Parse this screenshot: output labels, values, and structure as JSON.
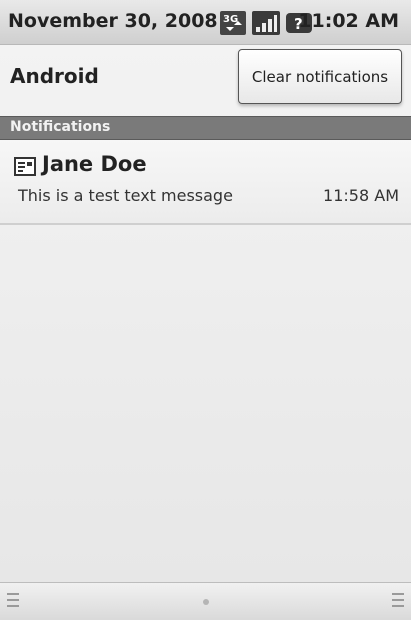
{
  "status_bar": {
    "date": "November 30, 2008",
    "time": "11:02 AM",
    "network_type": "3G",
    "icons": [
      "network-3g-icon",
      "signal-strength-icon",
      "battery-unknown-icon"
    ]
  },
  "header": {
    "title": "Android",
    "clear_button_label": "Clear notifications"
  },
  "section": {
    "label": "Notifications"
  },
  "notifications": [
    {
      "icon": "sms-message-icon",
      "title": "Jane Doe",
      "message": "This is a test text message",
      "time": "11:58 AM"
    }
  ],
  "colors": {
    "section_header_bg": "#7a7a7a",
    "status_bar_bg": "#d9d9d9",
    "text_dark": "#222222"
  }
}
